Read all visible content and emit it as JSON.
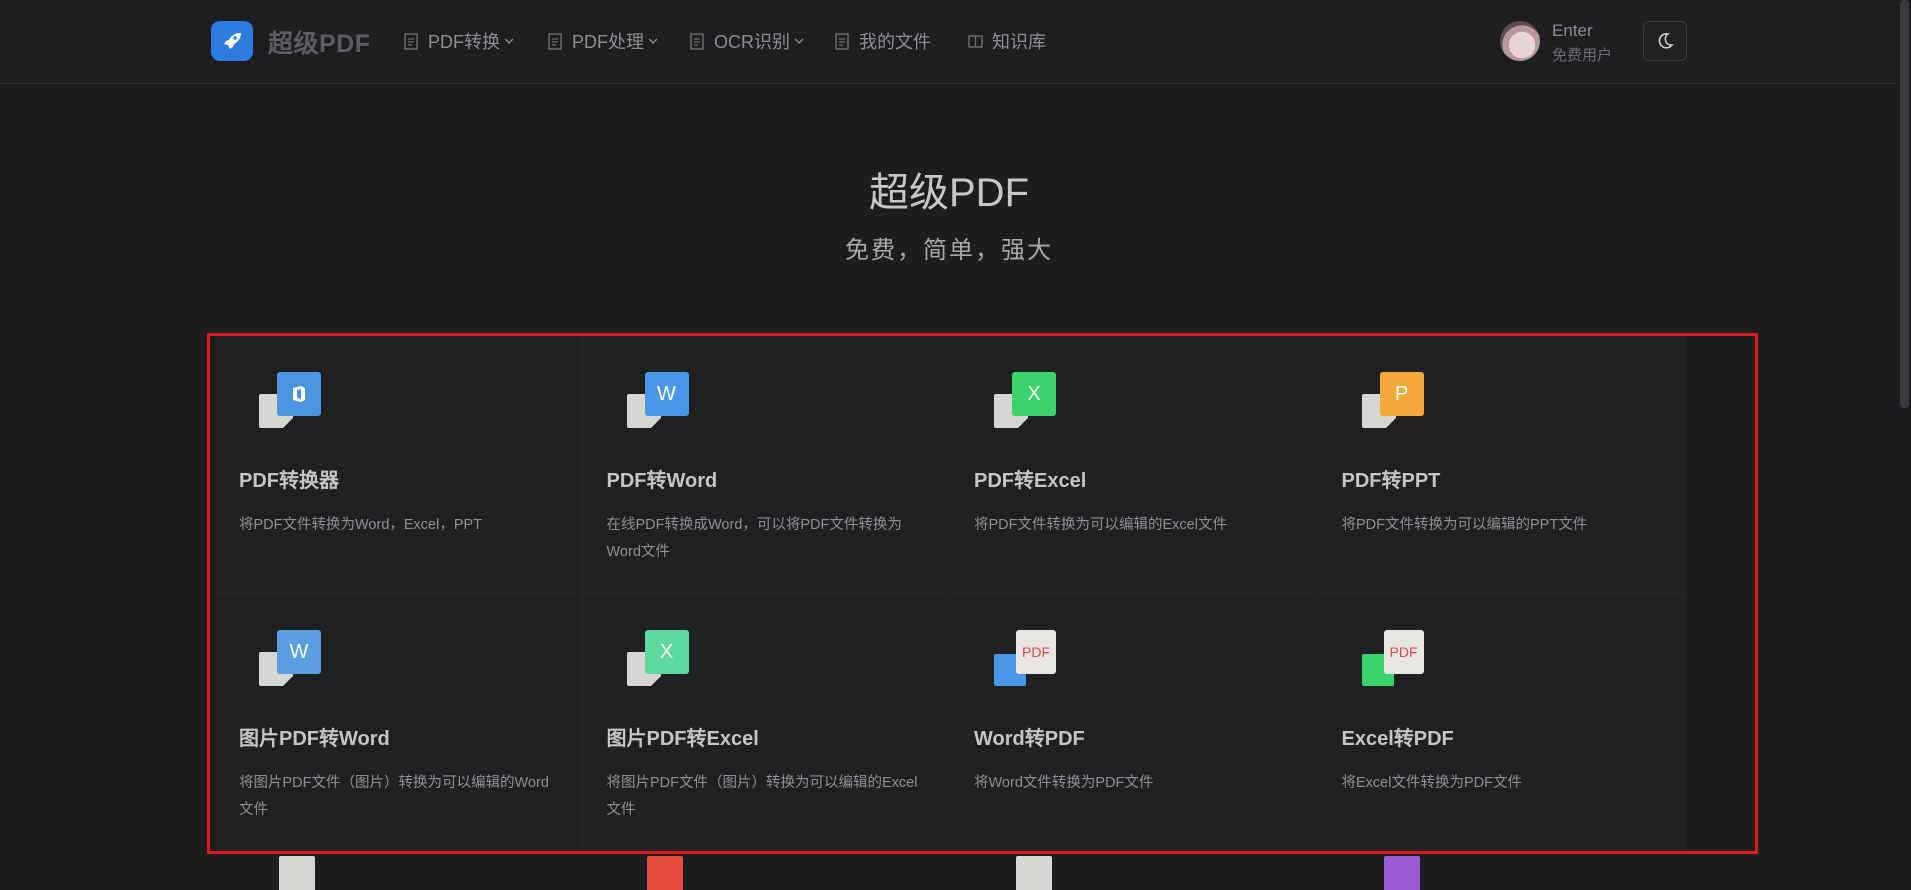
{
  "nav": {
    "brand": "超级PDF",
    "items": [
      {
        "label": "PDF转换",
        "dropdown": true
      },
      {
        "label": "PDF处理",
        "dropdown": true
      },
      {
        "label": "OCR识别",
        "dropdown": true
      },
      {
        "label": "我的文件",
        "dropdown": false
      },
      {
        "label": "知识库",
        "dropdown": false
      }
    ],
    "user": {
      "name": "Enter",
      "plan": "免费用户"
    }
  },
  "hero": {
    "title": "超级PDF",
    "subtitle": "免费，简单，强大"
  },
  "tools": [
    {
      "title": "PDF转换器",
      "desc": "将PDF文件转换为Word，Excel，PPT",
      "icon": "office-icon",
      "color": "#4a94e0",
      "letter": ""
    },
    {
      "title": "PDF转Word",
      "desc": "在线PDF转换成Word，可以将PDF文件转换为Word文件",
      "icon": "word-icon",
      "color": "#4a97e8",
      "letter": "W"
    },
    {
      "title": "PDF转Excel",
      "desc": "将PDF文件转换为可以编辑的Excel文件",
      "icon": "excel-icon",
      "color": "#3ad46b",
      "letter": "X"
    },
    {
      "title": "PDF转PPT",
      "desc": "将PDF文件转换为可以编辑的PPT文件",
      "icon": "ppt-icon",
      "color": "#f7a83b",
      "letter": "P"
    },
    {
      "title": "图片PDF转Word",
      "desc": "将图片PDF文件（图片）转换为可以编辑的Word文件",
      "icon": "word-icon",
      "color": "#5a9ee0",
      "letter": "W"
    },
    {
      "title": "图片PDF转Excel",
      "desc": "将图片PDF文件（图片）转换为可以编辑的Excel文件",
      "icon": "excel-icon",
      "color": "#5dd9a0",
      "letter": "X"
    },
    {
      "title": "Word转PDF",
      "desc": "将Word文件转换为PDF文件",
      "icon": "pdf-icon",
      "color": "#4a97e8",
      "letter": "PDF"
    },
    {
      "title": "Excel转PDF",
      "desc": "将Excel文件转换为PDF文件",
      "icon": "pdf-icon",
      "color": "#3ad46b",
      "letter": "PDF"
    }
  ],
  "peek_colors": [
    "#d8d6d2",
    "#e84c3d",
    "#d8d6d2",
    "#9b59d6"
  ]
}
